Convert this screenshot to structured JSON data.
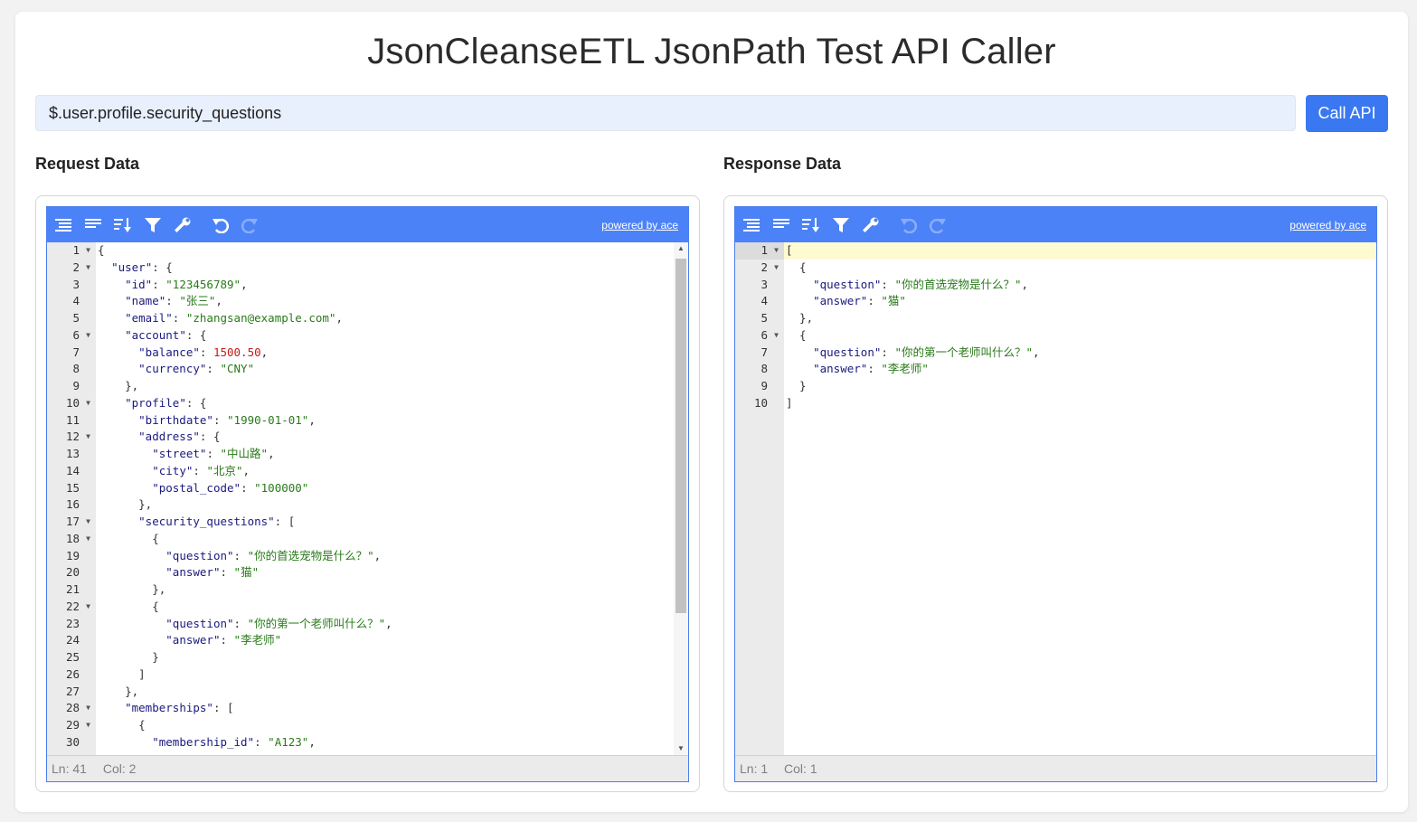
{
  "page": {
    "title": "JsonCleanseETL JsonPath Test API Caller",
    "path_input_value": "$.user.profile.security_questions",
    "call_button_label": "Call API",
    "request_label": "Request Data",
    "response_label": "Response Data"
  },
  "colors": {
    "accent": "#3a78f2",
    "menu_bar": "#4c82f7",
    "string": "#2a7a1a",
    "number": "#c41a16",
    "input_bg": "#e8f0fe"
  },
  "toolbar": {
    "icons": [
      "format-icon",
      "compact-icon",
      "sort-icon",
      "filter-icon",
      "repair-icon",
      "undo-icon",
      "redo-icon"
    ],
    "powered_by": "powered by ace"
  },
  "request_editor": {
    "status": {
      "ln": "Ln: 41",
      "col": "Col: 2"
    },
    "lines": [
      {
        "n": "1",
        "fold": true,
        "t": [
          [
            "p",
            "{"
          ]
        ]
      },
      {
        "n": "2",
        "fold": true,
        "t": [
          [
            "p",
            "  "
          ],
          [
            "k",
            "\"user\""
          ],
          [
            "p",
            ": {"
          ]
        ]
      },
      {
        "n": "3",
        "fold": false,
        "t": [
          [
            "p",
            "    "
          ],
          [
            "k",
            "\"id\""
          ],
          [
            "p",
            ": "
          ],
          [
            "s",
            "\"123456789\""
          ],
          [
            "p",
            ","
          ]
        ]
      },
      {
        "n": "4",
        "fold": false,
        "t": [
          [
            "p",
            "    "
          ],
          [
            "k",
            "\"name\""
          ],
          [
            "p",
            ": "
          ],
          [
            "s",
            "\"张三\""
          ],
          [
            "p",
            ","
          ]
        ]
      },
      {
        "n": "5",
        "fold": false,
        "t": [
          [
            "p",
            "    "
          ],
          [
            "k",
            "\"email\""
          ],
          [
            "p",
            ": "
          ],
          [
            "s",
            "\"zhangsan@example.com\""
          ],
          [
            "p",
            ","
          ]
        ]
      },
      {
        "n": "6",
        "fold": true,
        "t": [
          [
            "p",
            "    "
          ],
          [
            "k",
            "\"account\""
          ],
          [
            "p",
            ": {"
          ]
        ]
      },
      {
        "n": "7",
        "fold": false,
        "t": [
          [
            "p",
            "      "
          ],
          [
            "k",
            "\"balance\""
          ],
          [
            "p",
            ": "
          ],
          [
            "n",
            "1500.50"
          ],
          [
            "p",
            ","
          ]
        ]
      },
      {
        "n": "8",
        "fold": false,
        "t": [
          [
            "p",
            "      "
          ],
          [
            "k",
            "\"currency\""
          ],
          [
            "p",
            ": "
          ],
          [
            "s",
            "\"CNY\""
          ]
        ]
      },
      {
        "n": "9",
        "fold": false,
        "t": [
          [
            "p",
            "    },"
          ]
        ]
      },
      {
        "n": "10",
        "fold": true,
        "t": [
          [
            "p",
            "    "
          ],
          [
            "k",
            "\"profile\""
          ],
          [
            "p",
            ": {"
          ]
        ]
      },
      {
        "n": "11",
        "fold": false,
        "t": [
          [
            "p",
            "      "
          ],
          [
            "k",
            "\"birthdate\""
          ],
          [
            "p",
            ": "
          ],
          [
            "s",
            "\"1990-01-01\""
          ],
          [
            "p",
            ","
          ]
        ]
      },
      {
        "n": "12",
        "fold": true,
        "t": [
          [
            "p",
            "      "
          ],
          [
            "k",
            "\"address\""
          ],
          [
            "p",
            ": {"
          ]
        ]
      },
      {
        "n": "13",
        "fold": false,
        "t": [
          [
            "p",
            "        "
          ],
          [
            "k",
            "\"street\""
          ],
          [
            "p",
            ": "
          ],
          [
            "s",
            "\"中山路\""
          ],
          [
            "p",
            ","
          ]
        ]
      },
      {
        "n": "14",
        "fold": false,
        "t": [
          [
            "p",
            "        "
          ],
          [
            "k",
            "\"city\""
          ],
          [
            "p",
            ": "
          ],
          [
            "s",
            "\"北京\""
          ],
          [
            "p",
            ","
          ]
        ]
      },
      {
        "n": "15",
        "fold": false,
        "t": [
          [
            "p",
            "        "
          ],
          [
            "k",
            "\"postal_code\""
          ],
          [
            "p",
            ": "
          ],
          [
            "s",
            "\"100000\""
          ]
        ]
      },
      {
        "n": "16",
        "fold": false,
        "t": [
          [
            "p",
            "      },"
          ]
        ]
      },
      {
        "n": "17",
        "fold": true,
        "t": [
          [
            "p",
            "      "
          ],
          [
            "k",
            "\"security_questions\""
          ],
          [
            "p",
            ": ["
          ]
        ]
      },
      {
        "n": "18",
        "fold": true,
        "t": [
          [
            "p",
            "        {"
          ]
        ]
      },
      {
        "n": "19",
        "fold": false,
        "t": [
          [
            "p",
            "          "
          ],
          [
            "k",
            "\"question\""
          ],
          [
            "p",
            ": "
          ],
          [
            "s",
            "\"你的首选宠物是什么？\""
          ],
          [
            "p",
            ","
          ]
        ]
      },
      {
        "n": "20",
        "fold": false,
        "t": [
          [
            "p",
            "          "
          ],
          [
            "k",
            "\"answer\""
          ],
          [
            "p",
            ": "
          ],
          [
            "s",
            "\"猫\""
          ]
        ]
      },
      {
        "n": "21",
        "fold": false,
        "t": [
          [
            "p",
            "        },"
          ]
        ]
      },
      {
        "n": "22",
        "fold": true,
        "t": [
          [
            "p",
            "        {"
          ]
        ]
      },
      {
        "n": "23",
        "fold": false,
        "t": [
          [
            "p",
            "          "
          ],
          [
            "k",
            "\"question\""
          ],
          [
            "p",
            ": "
          ],
          [
            "s",
            "\"你的第一个老师叫什么？\""
          ],
          [
            "p",
            ","
          ]
        ]
      },
      {
        "n": "24",
        "fold": false,
        "t": [
          [
            "p",
            "          "
          ],
          [
            "k",
            "\"answer\""
          ],
          [
            "p",
            ": "
          ],
          [
            "s",
            "\"李老师\""
          ]
        ]
      },
      {
        "n": "25",
        "fold": false,
        "t": [
          [
            "p",
            "        }"
          ]
        ]
      },
      {
        "n": "26",
        "fold": false,
        "t": [
          [
            "p",
            "      ]"
          ]
        ]
      },
      {
        "n": "27",
        "fold": false,
        "t": [
          [
            "p",
            "    },"
          ]
        ]
      },
      {
        "n": "28",
        "fold": true,
        "t": [
          [
            "p",
            "    "
          ],
          [
            "k",
            "\"memberships\""
          ],
          [
            "p",
            ": ["
          ]
        ]
      },
      {
        "n": "29",
        "fold": true,
        "t": [
          [
            "p",
            "      {"
          ]
        ]
      },
      {
        "n": "30",
        "fold": false,
        "t": [
          [
            "p",
            "        "
          ],
          [
            "k",
            "\"membership_id\""
          ],
          [
            "p",
            ": "
          ],
          [
            "s",
            "\"A123\""
          ],
          [
            "p",
            ","
          ]
        ]
      }
    ]
  },
  "response_editor": {
    "status": {
      "ln": "Ln: 1",
      "col": "Col: 1"
    },
    "lines": [
      {
        "n": "1",
        "fold": true,
        "t": [
          [
            "p",
            "["
          ]
        ]
      },
      {
        "n": "2",
        "fold": true,
        "t": [
          [
            "p",
            "  {"
          ]
        ]
      },
      {
        "n": "3",
        "fold": false,
        "t": [
          [
            "p",
            "    "
          ],
          [
            "k",
            "\"question\""
          ],
          [
            "p",
            ": "
          ],
          [
            "s",
            "\"你的首选宠物是什么？\""
          ],
          [
            "p",
            ","
          ]
        ]
      },
      {
        "n": "4",
        "fold": false,
        "t": [
          [
            "p",
            "    "
          ],
          [
            "k",
            "\"answer\""
          ],
          [
            "p",
            ": "
          ],
          [
            "s",
            "\"猫\""
          ]
        ]
      },
      {
        "n": "5",
        "fold": false,
        "t": [
          [
            "p",
            "  },"
          ]
        ]
      },
      {
        "n": "6",
        "fold": true,
        "t": [
          [
            "p",
            "  {"
          ]
        ]
      },
      {
        "n": "7",
        "fold": false,
        "t": [
          [
            "p",
            "    "
          ],
          [
            "k",
            "\"question\""
          ],
          [
            "p",
            ": "
          ],
          [
            "s",
            "\"你的第一个老师叫什么？\""
          ],
          [
            "p",
            ","
          ]
        ]
      },
      {
        "n": "8",
        "fold": false,
        "t": [
          [
            "p",
            "    "
          ],
          [
            "k",
            "\"answer\""
          ],
          [
            "p",
            ": "
          ],
          [
            "s",
            "\"李老师\""
          ]
        ]
      },
      {
        "n": "9",
        "fold": false,
        "t": [
          [
            "p",
            "  }"
          ]
        ]
      },
      {
        "n": "10",
        "fold": false,
        "t": [
          [
            "p",
            "]"
          ]
        ]
      }
    ]
  }
}
